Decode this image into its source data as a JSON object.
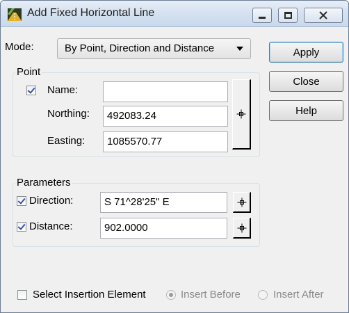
{
  "window": {
    "title": "Add Fixed Horizontal Line",
    "app_icon": "road-design-icon"
  },
  "mode": {
    "label": "Mode:",
    "selected": "By Point, Direction and Distance"
  },
  "buttons": {
    "apply": "Apply",
    "close": "Close",
    "help": "Help"
  },
  "point_group": {
    "title": "Point",
    "name_label": "Name:",
    "name_checked": true,
    "name_value": "",
    "northing_label": "Northing:",
    "northing_value": "492083.24",
    "easting_label": "Easting:",
    "easting_value": "1085570.77"
  },
  "parameters_group": {
    "title": "Parameters",
    "direction_label": "Direction:",
    "direction_checked": true,
    "direction_value": "S 71^28'25\" E",
    "distance_label": "Distance:",
    "distance_checked": true,
    "distance_value": "902.0000"
  },
  "insertion": {
    "select_label": "Select Insertion Element",
    "select_checked": false,
    "insert_before_label": "Insert Before",
    "insert_before_selected": true,
    "insert_after_label": "Insert After",
    "insert_after_selected": false
  }
}
